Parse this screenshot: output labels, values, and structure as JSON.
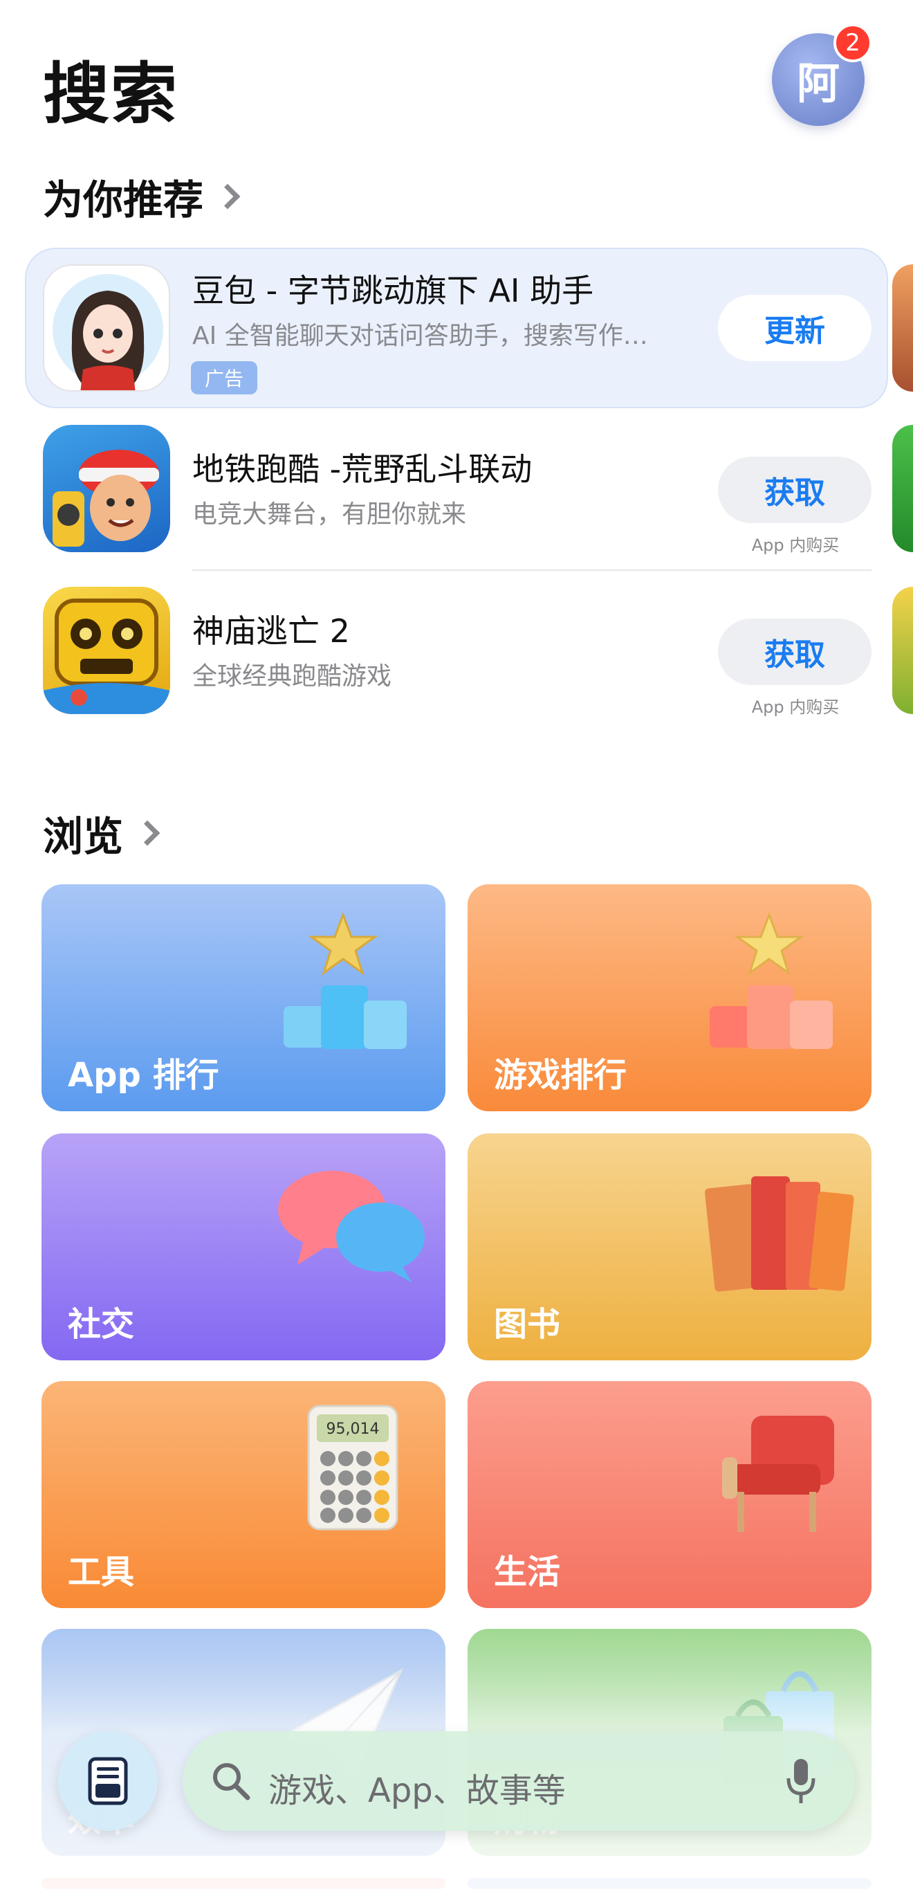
{
  "header": {
    "title": "搜索",
    "avatar_text": "阿",
    "badge_count": "2"
  },
  "recommend": {
    "title": "为你推荐",
    "apps": [
      {
        "name": "豆包 - 字节跳动旗下 AI 助手",
        "subtitle": "AI 全智能聊天对话问答助手，搜索写作…",
        "tag": "广告",
        "button": "更新"
      },
      {
        "name": "地铁跑酷 -荒野乱斗联动",
        "subtitle": "电竞大舞台，有胆你就来",
        "button": "获取",
        "iap": "App 内购买"
      },
      {
        "name": "神庙逃亡 2",
        "subtitle": "全球经典跑酷游戏",
        "button": "获取",
        "iap": "App 内购买"
      }
    ]
  },
  "browse": {
    "title": "浏览",
    "tiles": [
      {
        "label": "App 排行",
        "color_top": "#a9c6f7",
        "color_bottom": "#5b9bef"
      },
      {
        "label": "游戏排行",
        "color_top": "#fdb985",
        "color_bottom": "#f98a3a"
      },
      {
        "label": "社交",
        "color_top": "#b8a3f7",
        "color_bottom": "#8468f2"
      },
      {
        "label": "图书",
        "color_top": "#f7d48f",
        "color_bottom": "#eeb040"
      },
      {
        "label": "工具",
        "color_top": "#fbb577",
        "color_bottom": "#f98a35"
      },
      {
        "label": "生活",
        "color_top": "#fc9e8e",
        "color_bottom": "#f57260"
      },
      {
        "label": "效率",
        "color_top": "#a9c6f4",
        "color_bottom": "#6e9bd8"
      },
      {
        "label": "购物",
        "color_top": "#9ed890",
        "color_bottom": "#6bbf5c"
      }
    ]
  },
  "bottom_bar": {
    "search_placeholder": "游戏、App、故事等"
  },
  "icons": [
    "library-icon",
    "search-icon",
    "microphone-icon",
    "chevron-right-icon"
  ],
  "colors": {
    "accent": "#1a7cf0",
    "badge": "#ff3b30"
  }
}
